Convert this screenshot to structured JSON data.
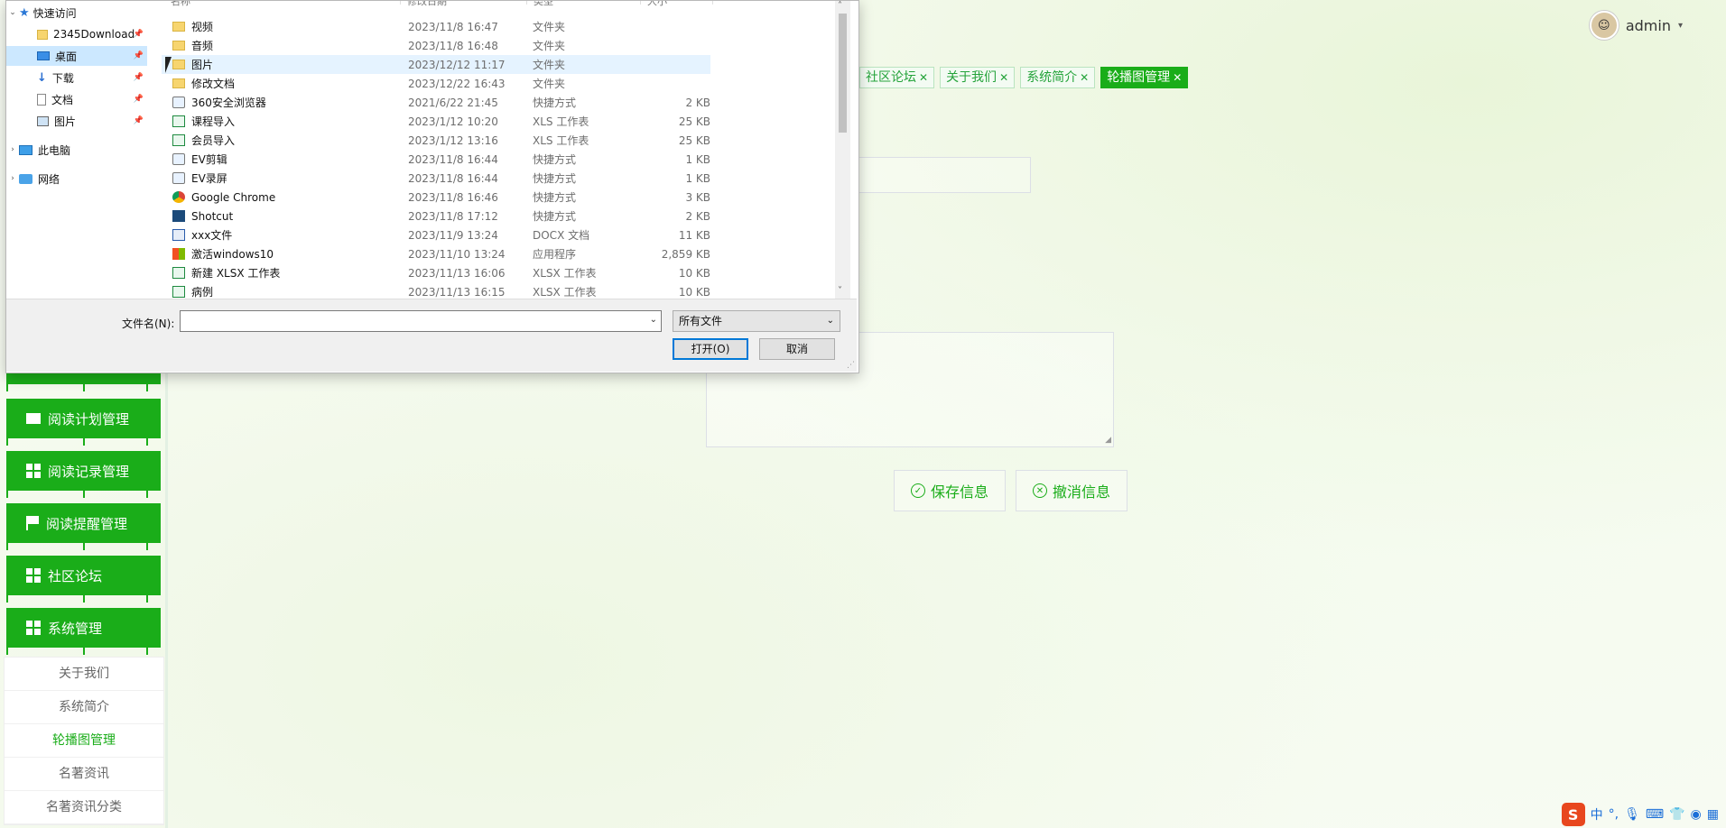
{
  "header": {
    "username": "admin"
  },
  "tags": [
    {
      "label": "社区论坛"
    },
    {
      "label": "关于我们"
    },
    {
      "label": "系统简介"
    },
    {
      "label": "轮播图管理",
      "active": true
    }
  ],
  "buttons": {
    "save": "保存信息",
    "cancel": "撤消信息"
  },
  "sidebar": {
    "menus": [
      {
        "label": "阅读计划管理",
        "icon": "monitor-icon"
      },
      {
        "label": "阅读记录管理",
        "icon": "grid-icon"
      },
      {
        "label": "阅读提醒管理",
        "icon": "flag-icon"
      },
      {
        "label": "社区论坛",
        "icon": "grid-icon"
      },
      {
        "label": "系统管理",
        "icon": "grid-icon"
      }
    ],
    "submenu": [
      {
        "label": "关于我们"
      },
      {
        "label": "系统简介"
      },
      {
        "label": "轮播图管理",
        "active": true
      },
      {
        "label": "名著资讯"
      },
      {
        "label": "名著资讯分类"
      }
    ]
  },
  "tray": {
    "ime": "中"
  },
  "dialog": {
    "columns": {
      "name": "名称",
      "date": "修改日期",
      "type": "类型",
      "size": "大小"
    },
    "nav": [
      {
        "label": "快速访问",
        "icon": "star-icon",
        "expanded": true
      },
      {
        "label": "2345Download",
        "icon": "folder-icon",
        "pinned": true
      },
      {
        "label": "桌面",
        "icon": "desktop-icon",
        "pinned": true,
        "selected": true
      },
      {
        "label": "下载",
        "icon": "download-icon",
        "pinned": true
      },
      {
        "label": "文档",
        "icon": "document-icon",
        "pinned": true
      },
      {
        "label": "图片",
        "icon": "picture-icon",
        "pinned": true
      },
      {
        "label": "此电脑",
        "icon": "computer-icon"
      },
      {
        "label": "网络",
        "icon": "network-icon"
      }
    ],
    "files": [
      {
        "name": "视频",
        "date": "2023/11/8 16:47",
        "type": "文件夹",
        "size": "",
        "icon": "folder"
      },
      {
        "name": "音频",
        "date": "2023/11/8 16:48",
        "type": "文件夹",
        "size": "",
        "icon": "folder"
      },
      {
        "name": "图片",
        "date": "2023/12/12 11:17",
        "type": "文件夹",
        "size": "",
        "icon": "folder",
        "hover": true
      },
      {
        "name": "修改文档",
        "date": "2023/12/22 16:43",
        "type": "文件夹",
        "size": "",
        "icon": "folder"
      },
      {
        "name": "360安全浏览器",
        "date": "2021/6/22 21:45",
        "type": "快捷方式",
        "size": "2 KB",
        "icon": "lnk"
      },
      {
        "name": "课程导入",
        "date": "2023/1/12 10:20",
        "type": "XLS 工作表",
        "size": "25 KB",
        "icon": "xls"
      },
      {
        "name": "会员导入",
        "date": "2023/1/12 13:16",
        "type": "XLS 工作表",
        "size": "25 KB",
        "icon": "xls"
      },
      {
        "name": "EV剪辑",
        "date": "2023/11/8 16:44",
        "type": "快捷方式",
        "size": "1 KB",
        "icon": "lnk"
      },
      {
        "name": "EV录屏",
        "date": "2023/11/8 16:44",
        "type": "快捷方式",
        "size": "1 KB",
        "icon": "lnk"
      },
      {
        "name": "Google Chrome",
        "date": "2023/11/8 16:46",
        "type": "快捷方式",
        "size": "3 KB",
        "icon": "chrome"
      },
      {
        "name": "Shotcut",
        "date": "2023/11/8 17:12",
        "type": "快捷方式",
        "size": "2 KB",
        "icon": "shotcut"
      },
      {
        "name": "xxx文件",
        "date": "2023/11/9 13:24",
        "type": "DOCX 文档",
        "size": "11 KB",
        "icon": "docx"
      },
      {
        "name": "激活windows10",
        "date": "2023/11/10 13:24",
        "type": "应用程序",
        "size": "2,859 KB",
        "icon": "exe"
      },
      {
        "name": "新建 XLSX 工作表",
        "date": "2023/11/13 16:06",
        "type": "XLSX 工作表",
        "size": "10 KB",
        "icon": "xls"
      },
      {
        "name": "病例",
        "date": "2023/11/13 16:15",
        "type": "XLSX 工作表",
        "size": "10 KB",
        "icon": "xls"
      }
    ],
    "filename_label": "文件名(N):",
    "filename_value": "",
    "filetype": "所有文件",
    "open_label": "打开(O)",
    "cancel_label": "取消"
  }
}
